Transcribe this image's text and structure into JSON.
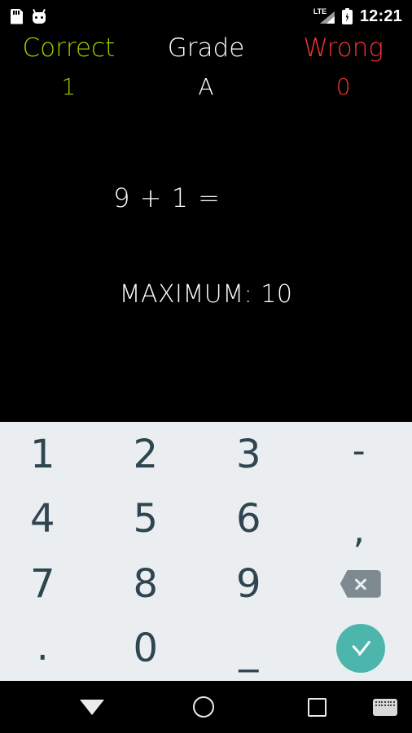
{
  "status_bar": {
    "time": "12:21",
    "icons": [
      "sd-card-icon",
      "robot-icon",
      "lte-signal-icon",
      "battery-charging-icon"
    ],
    "network_label": "LTE"
  },
  "score": {
    "correct": {
      "label": "Correct",
      "value": "1",
      "color": "#9ACD00"
    },
    "grade": {
      "label": "Grade",
      "value": "A",
      "color": "#FFFFFF"
    },
    "wrong": {
      "label": "Wrong",
      "value": "0",
      "color": "#F0372E"
    }
  },
  "problem": {
    "equation": "9 + 1 =",
    "maximum": "MAXIMUM: 10"
  },
  "keypad": {
    "background_color": "#EAEEF1",
    "key_color": "#2F4550",
    "accent_color": "#4DB6AC",
    "keys": [
      {
        "label": "1",
        "name": "key-1"
      },
      {
        "label": "2",
        "name": "key-2"
      },
      {
        "label": "3",
        "name": "key-3"
      },
      {
        "label": "-",
        "name": "key-minus"
      },
      {
        "label": "4",
        "name": "key-4"
      },
      {
        "label": "5",
        "name": "key-5"
      },
      {
        "label": "6",
        "name": "key-6"
      },
      {
        "label": ",",
        "name": "key-comma"
      },
      {
        "label": "7",
        "name": "key-7"
      },
      {
        "label": "8",
        "name": "key-8"
      },
      {
        "label": "9",
        "name": "key-9"
      },
      {
        "label": "",
        "name": "key-backspace"
      },
      {
        "label": ".",
        "name": "key-period"
      },
      {
        "label": "0",
        "name": "key-0"
      },
      {
        "label": "_",
        "name": "key-underscore"
      },
      {
        "label": "",
        "name": "key-enter"
      }
    ]
  },
  "nav_bar": {
    "back": "hide-keyboard-icon",
    "home": "home-icon",
    "recents": "recents-icon",
    "switch_keyboard": "keyboard-switcher-icon"
  }
}
